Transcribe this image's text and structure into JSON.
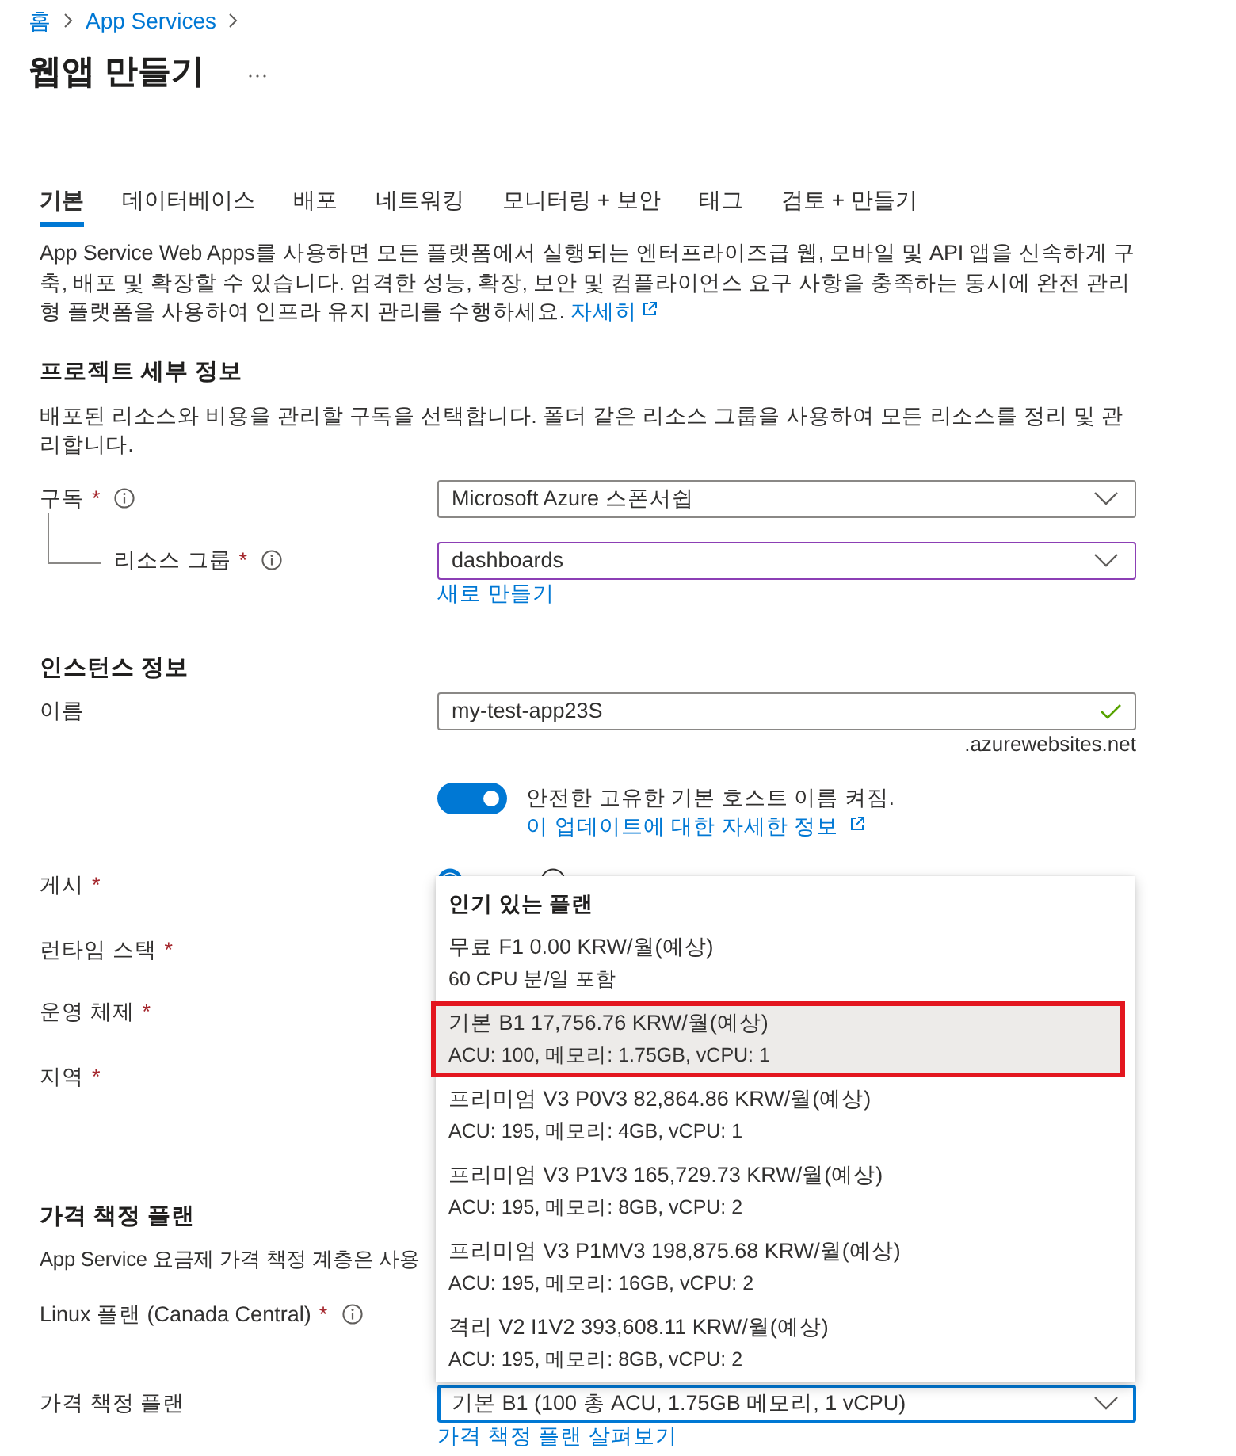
{
  "breadcrumb": [
    {
      "label": "홈"
    },
    {
      "label": "App Services"
    }
  ],
  "title": "웹앱 만들기",
  "tabs": [
    {
      "label": "기본",
      "selected": true
    },
    {
      "label": "데이터베이스",
      "selected": false
    },
    {
      "label": "배포",
      "selected": false
    },
    {
      "label": "네트워킹",
      "selected": false
    },
    {
      "label": "모니터링 + 보안",
      "selected": false
    },
    {
      "label": "태그",
      "selected": false
    },
    {
      "label": "검토 + 만들기",
      "selected": false
    }
  ],
  "intro": {
    "text": "App Service Web Apps를 사용하면 모든 플랫폼에서 실행되는 엔터프라이즈급 웹, 모바일 및 API 앱을 신속하게 구축, 배포 및 확장할 수 있습니다. 엄격한 성능, 확장, 보안 및 컴플라이언스 요구 사항을 충족하는 동시에 완전 관리형 플랫폼을 사용하여 인프라 유지 관리를 수행하세요.",
    "link": "자세히"
  },
  "project_details": {
    "heading": "프로젝트 세부 정보",
    "description": "배포된 리소스와 비용을 관리할 구독을 선택합니다. 폴더 같은 리소스 그룹을 사용하여 모든 리소스를 정리 및 관리합니다.",
    "subscription": {
      "label": "구독",
      "required_mark": "*",
      "info": true,
      "value": "Microsoft Azure 스폰서쉽"
    },
    "resource_group": {
      "label": "리소스 그룹",
      "required_mark": "*",
      "info": true,
      "value": "dashboards",
      "hovered": true,
      "link": "새로 만들기"
    }
  },
  "instance_details": {
    "heading": "인스턴스 정보",
    "name": {
      "label": "이름",
      "value": "my-test-app23S",
      "valid": true,
      "suffix": ".azurewebsites.net"
    },
    "secure_hostname": {
      "on": true,
      "text": "안전한 고유한 기본 호스트 이름 켜짐.",
      "link": "이 업데이트에 대한 자세한 정보"
    },
    "publish": {
      "label": "게시",
      "required_mark": "*",
      "options": [
        {
          "selected": true
        },
        {
          "selected": false
        }
      ]
    },
    "runtime_stack": {
      "label": "런타임 스택",
      "required_mark": "*"
    },
    "operating_system": {
      "label": "운영 체제",
      "required_mark": "*"
    },
    "region": {
      "label": "지역",
      "required_mark": "*"
    }
  },
  "pricing": {
    "heading": "가격 책정 플랜",
    "description": "App Service 요금제 가격 책정 계층은 사용",
    "linux_plan": {
      "label": "Linux 플랜 (Canada Central)",
      "required_mark": "*",
      "info": true
    },
    "pricing_plan": {
      "label": "가격 책정 플랜",
      "value": "기본 B1 (100 총 ACU, 1.75GB 메모리, 1 vCPU)",
      "focused": true,
      "link": "가격 책정 플랜 살펴보기"
    }
  },
  "plan_dropdown": {
    "heading": "인기 있는 플랜",
    "items": [
      {
        "title": "무료 F1 0.00 KRW/월(예상)",
        "detail": "60 CPU 분/일 포함",
        "selected": false,
        "highlighted": false
      },
      {
        "title": "기본 B1 17,756.76 KRW/월(예상)",
        "detail": "ACU: 100, 메모리: 1.75GB, vCPU: 1",
        "selected": true,
        "highlighted": true
      },
      {
        "title": "프리미엄 V3 P0V3 82,864.86 KRW/월(예상)",
        "detail": "ACU: 195, 메모리: 4GB, vCPU: 1",
        "selected": false,
        "highlighted": false
      },
      {
        "title": "프리미엄 V3 P1V3 165,729.73 KRW/월(예상)",
        "detail": "ACU: 195, 메모리: 8GB, vCPU: 2",
        "selected": false,
        "highlighted": false
      },
      {
        "title": "프리미엄 V3 P1MV3 198,875.68 KRW/월(예상)",
        "detail": "ACU: 195, 메모리: 16GB, vCPU: 2",
        "selected": false,
        "highlighted": false
      },
      {
        "title": "격리 V2 I1V2 393,608.11 KRW/월(예상)",
        "detail": "ACU: 195, 메모리: 8GB, vCPU: 2",
        "selected": false,
        "highlighted": false
      }
    ]
  }
}
